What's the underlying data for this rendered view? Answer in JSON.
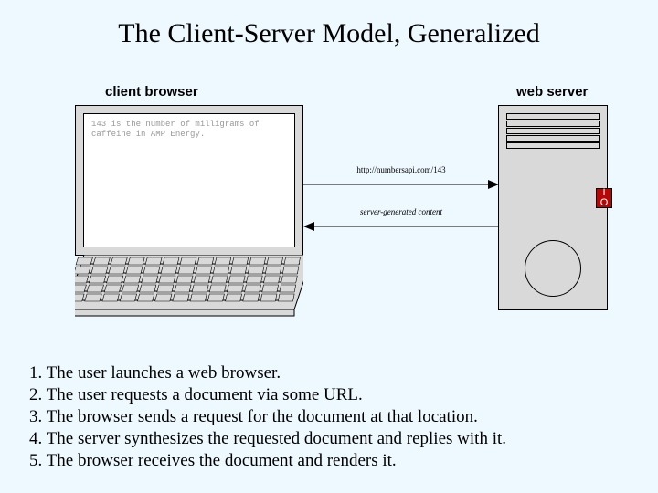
{
  "title": "The Client-Server Model, Generalized",
  "labels": {
    "client": "client browser",
    "server": "web server"
  },
  "screen_text": "143 is the number of milligrams of\ncaffeine in AMP Energy.",
  "arrows": {
    "request": "http://numbersapi.com/143",
    "response": "server-generated content"
  },
  "badge": {
    "line1": "I",
    "line2": "O"
  },
  "steps": [
    "1. The user launches a web browser.",
    "2. The user requests a document via some URL.",
    "3. The browser sends a request for the document at that location.",
    "4. The server synthesizes the requested document and replies with it.",
    "5. The browser receives the document and renders it."
  ]
}
